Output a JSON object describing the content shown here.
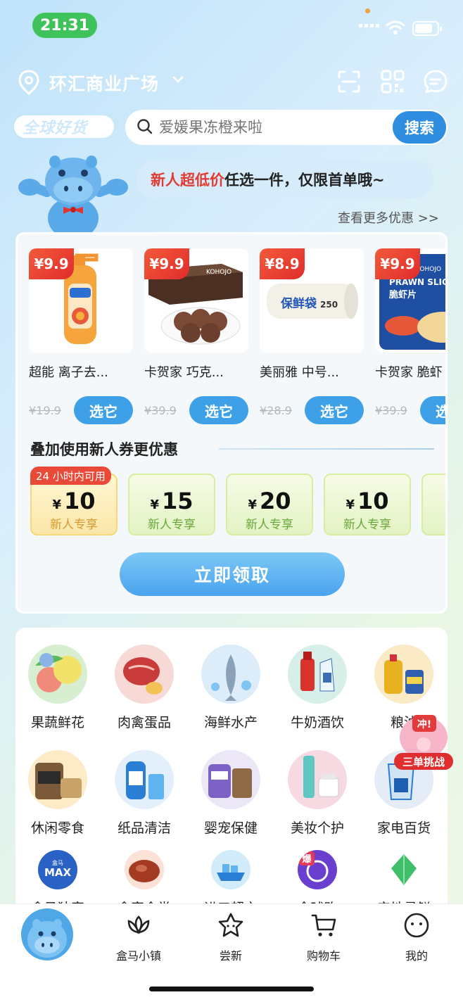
{
  "status_bar": {
    "time": "21:31"
  },
  "header": {
    "location": "环汇商业广场",
    "icons": [
      "scan-icon",
      "qrcode-icon",
      "message-icon"
    ]
  },
  "search": {
    "badge": "全球好货",
    "placeholder": "爱媛果冻橙来啦",
    "button": "搜索"
  },
  "promo": {
    "bubble_red": "新人超低价",
    "bubble_rest": "任选一件，仅限首单哦~",
    "more": "查看更多优惠 >>"
  },
  "products": [
    {
      "price": "¥9.9",
      "name": "超能 离子去...",
      "old_price": "¥19.9",
      "button": "选它"
    },
    {
      "price": "¥9.9",
      "name": "卡贺家 巧克...",
      "old_price": "¥39.9",
      "button": "选它"
    },
    {
      "price": "¥8.9",
      "name": "美丽雅 中号...",
      "old_price": "¥28.9",
      "button": "选它"
    },
    {
      "price": "¥9.9",
      "name": "卡贺家 脆虾",
      "old_price": "¥39.9",
      "button": "选它"
    }
  ],
  "coupons": {
    "title": "叠加使用新人券更优惠",
    "first_tag": "24 小时内可用",
    "currency": "¥",
    "items": [
      {
        "amount": "10",
        "label": "新人专享"
      },
      {
        "amount": "15",
        "label": "新人专享"
      },
      {
        "amount": "20",
        "label": "新人专享"
      },
      {
        "amount": "10",
        "label": "新人专享"
      },
      {
        "amount": "",
        "label": "新"
      }
    ],
    "claim_button": "立即领取"
  },
  "categories": [
    {
      "label": "果蔬鲜花"
    },
    {
      "label": "肉禽蛋品"
    },
    {
      "label": "海鲜水产"
    },
    {
      "label": "牛奶酒饮"
    },
    {
      "label": "粮油"
    },
    {
      "label": "休闲零食"
    },
    {
      "label": "纸品清洁"
    },
    {
      "label": "婴宠保健"
    },
    {
      "label": "美妆个护"
    },
    {
      "label": "家电百货"
    },
    {
      "label": "盒马独家"
    },
    {
      "label": "盒家食堂"
    },
    {
      "label": "进口超市"
    },
    {
      "label": "全球购"
    },
    {
      "label": "产地寻鲜"
    }
  ],
  "small_icon_text": {
    "max": "MAX",
    "max_top": "盒马",
    "bao": "爆"
  },
  "challenge": {
    "top": "冲!",
    "label": "三单挑战"
  },
  "product_image_text": {
    "p2_brand": "KOHOJO",
    "p3_text": "保鲜袋",
    "p3_num": "250",
    "p4_brand": "KOHOJO",
    "p4_en": "PRAWN SLICES",
    "p4_cn": "脆虾片"
  },
  "nav": {
    "items": [
      {
        "label": "盒马小镇"
      },
      {
        "label": "尝新"
      },
      {
        "label": "购物车"
      },
      {
        "label": "我的"
      }
    ]
  }
}
